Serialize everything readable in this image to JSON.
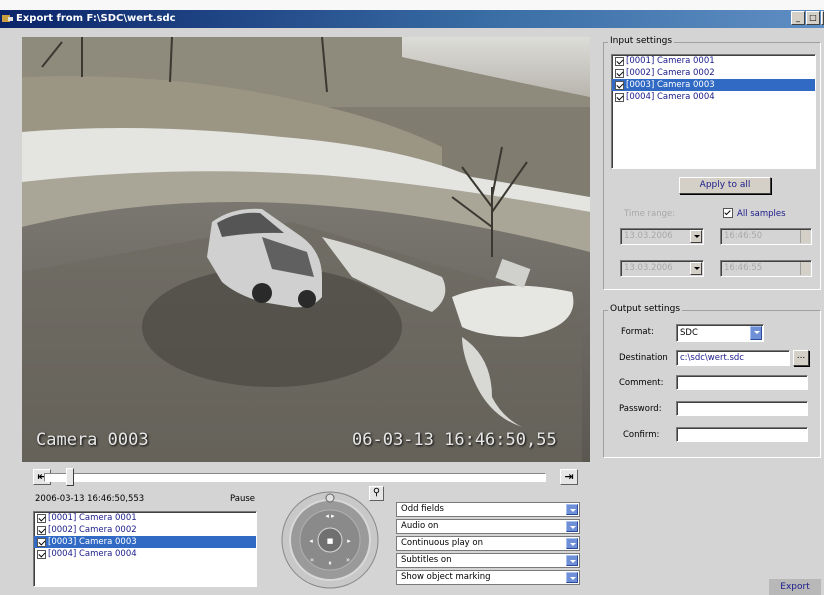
{
  "window": {
    "title": "Export from F:\\SDC\\wert.sdc"
  },
  "video": {
    "camera_label": "Camera 0003",
    "timestamp": "06-03-13  16:46:50,55"
  },
  "input_settings": {
    "legend": "Input settings",
    "cameras": [
      {
        "label": "[0001] Camera 0001",
        "checked": true,
        "selected": false
      },
      {
        "label": "[0002] Camera 0002",
        "checked": true,
        "selected": false
      },
      {
        "label": "[0003] Camera 0003",
        "checked": true,
        "selected": true
      },
      {
        "label": "[0004] Camera 0004",
        "checked": true,
        "selected": false
      }
    ],
    "apply_to_all": "Apply to all",
    "time_range_label": "Time range:",
    "all_samples_label": "All samples",
    "all_samples_checked": true,
    "start_date": "13.03.2006",
    "start_time": "16:46:50",
    "end_date": "13.03.2006",
    "end_time": "16:46:55"
  },
  "output_settings": {
    "legend": "Output settings",
    "format_label": "Format:",
    "format_value": "SDC",
    "destination_label": "Destination",
    "destination_value": "c:\\sdc\\wert.sdc",
    "browse_label": "...",
    "comment_label": "Comment:",
    "comment_value": "",
    "password_label": "Password:",
    "password_value": "",
    "confirm_label": "Confirm:",
    "confirm_value": ""
  },
  "playback": {
    "current_time": "2006-03-13 16:46:50,553",
    "state": "Pause",
    "slider_position": 0.04,
    "cameras": [
      {
        "label": "[0001] Camera 0001",
        "checked": true,
        "selected": false
      },
      {
        "label": "[0002] Camera 0002",
        "checked": true,
        "selected": false
      },
      {
        "label": "[0003] Camera 0003",
        "checked": true,
        "selected": true
      },
      {
        "label": "[0004] Camera 0004",
        "checked": true,
        "selected": false
      }
    ],
    "options": [
      "Odd fields",
      "Audio on",
      "Continuous play on",
      "Subtitles on",
      "Show object marking"
    ]
  },
  "footer": {
    "export_label": "Export"
  },
  "colors": {
    "selection": "#316ac5",
    "titlebar": "#0a246a",
    "list_text": "#1a1a8a"
  }
}
